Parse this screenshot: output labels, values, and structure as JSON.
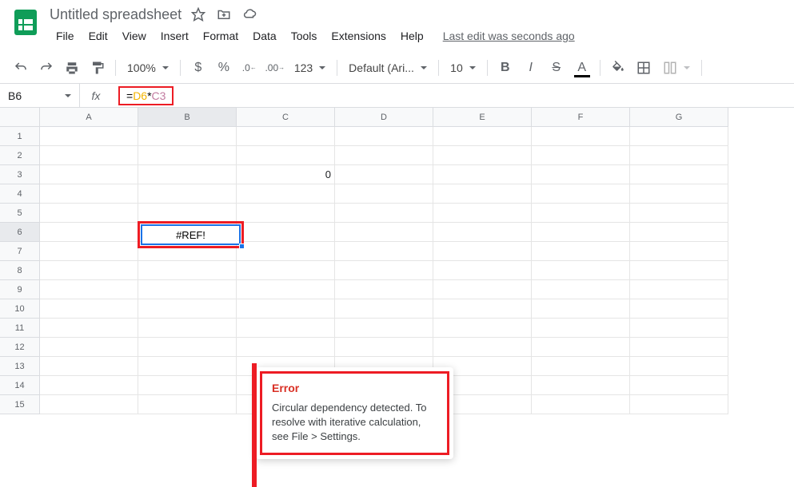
{
  "doc": {
    "title": "Untitled spreadsheet"
  },
  "menus": {
    "file": "File",
    "edit": "Edit",
    "view": "View",
    "insert": "Insert",
    "format": "Format",
    "data": "Data",
    "tools": "Tools",
    "extensions": "Extensions",
    "help": "Help"
  },
  "last_edit": "Last edit was seconds ago",
  "toolbar": {
    "zoom": "100%",
    "currency": "$",
    "percent": "%",
    "numfmt": "123",
    "font": "Default (Ari...",
    "fontsize": "10"
  },
  "namebox": "B6",
  "formula": {
    "eq": "=",
    "ref1": "D6",
    "op": "*",
    "ref2": "C3"
  },
  "cells": {
    "c3": "0"
  },
  "selected": {
    "value": "#REF!"
  },
  "tooltip": {
    "title": "Error",
    "msg": "Circular dependency detected. To resolve with iterative calculation, see File > Settings."
  },
  "cols": [
    "A",
    "B",
    "C",
    "D",
    "E",
    "F",
    "G"
  ],
  "rows": [
    "1",
    "2",
    "3",
    "4",
    "5",
    "6",
    "7",
    "8",
    "9",
    "10",
    "11",
    "12",
    "13",
    "14",
    "15"
  ]
}
